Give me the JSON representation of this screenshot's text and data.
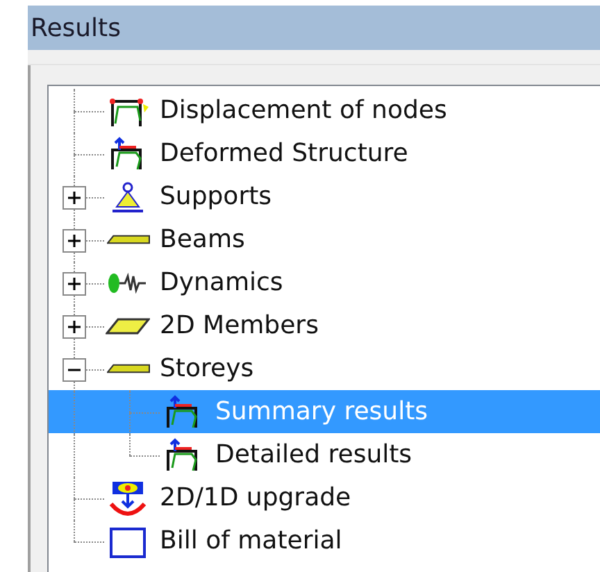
{
  "window": {
    "title": "Results"
  },
  "tree": [
    {
      "label": "Displacement of nodes",
      "kind": "frame",
      "selected": false
    },
    {
      "label": "Deformed Structure",
      "kind": "deformed",
      "selected": false
    },
    {
      "label": "Supports",
      "kind": "support",
      "expanded": false,
      "selected": false
    },
    {
      "label": "Beams",
      "kind": "beam",
      "expanded": false,
      "selected": false
    },
    {
      "label": "Dynamics",
      "kind": "spring",
      "expanded": false,
      "selected": false
    },
    {
      "label": "2D Members",
      "kind": "plate",
      "expanded": false,
      "selected": false
    },
    {
      "label": "Storeys",
      "kind": "beam",
      "expanded": true,
      "selected": false,
      "children": [
        {
          "label": "Summary results",
          "kind": "deformed",
          "selected": true
        },
        {
          "label": "Detailed results",
          "kind": "deformed",
          "selected": false
        }
      ]
    },
    {
      "label": "2D/1D upgrade",
      "kind": "upgrade",
      "selected": false
    },
    {
      "label": "Bill of material",
      "kind": "bill",
      "selected": false
    }
  ]
}
